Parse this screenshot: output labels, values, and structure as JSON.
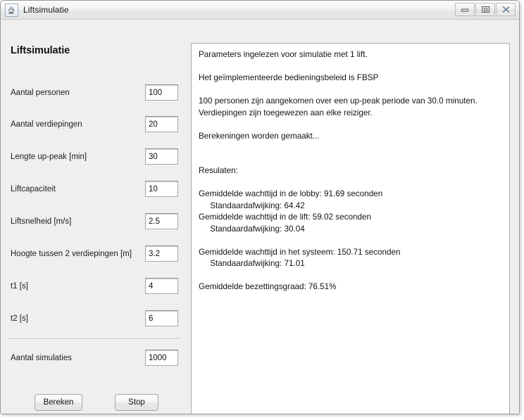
{
  "window": {
    "title": "Liftsimulatie",
    "icon": "java-coffee-cup-icon",
    "controls": {
      "minimize_label": "–",
      "maximize_label": "❐",
      "close_label": "✖"
    }
  },
  "sidebar": {
    "heading": "Liftsimulatie",
    "fields": [
      {
        "label": "Aantal personen",
        "value": "100"
      },
      {
        "label": "Aantal verdiepingen",
        "value": "20"
      },
      {
        "label": "Lengte up-peak [min]",
        "value": "30"
      },
      {
        "label": "Liftcapaciteit",
        "value": "10"
      },
      {
        "label": "Liftsnelheid [m/s]",
        "value": "2.5"
      },
      {
        "label": "Hoogte tussen 2 verdiepingen [m]",
        "value": "3.2"
      },
      {
        "label": "t1 [s]",
        "value": "4"
      },
      {
        "label": "t2 [s]",
        "value": "6"
      }
    ],
    "simulations": {
      "label": "Aantal simulaties",
      "value": "1000"
    },
    "buttons": {
      "calculate": "Bereken",
      "stop": "Stop"
    }
  },
  "output": {
    "text": "Parameters ingelezen voor simulatie met 1 lift.\n\nHet geïmplementeerde bedieningsbeleid is FBSP\n\n100 personen zijn aangekomen over een up-peak periode van 30.0 minuten.\nVerdiepingen zijn toegewezen aan elke reiziger.\n\nBerekeningen worden gemaakt...\n\n\nResulaten:\n\nGemiddelde wachttijd in de lobby: 91.69 seconden\n     Standaardafwijking: 64.42\nGemiddelde wachttijd in de lift: 59.02 seconden\n     Standaardafwijking: 30.04\n\nGemiddelde wachttijd in het systeem: 150.71 seconden\n     Standaardafwijking: 71.01\n\nGemiddelde bezettingsgraad: 76.51%"
  }
}
